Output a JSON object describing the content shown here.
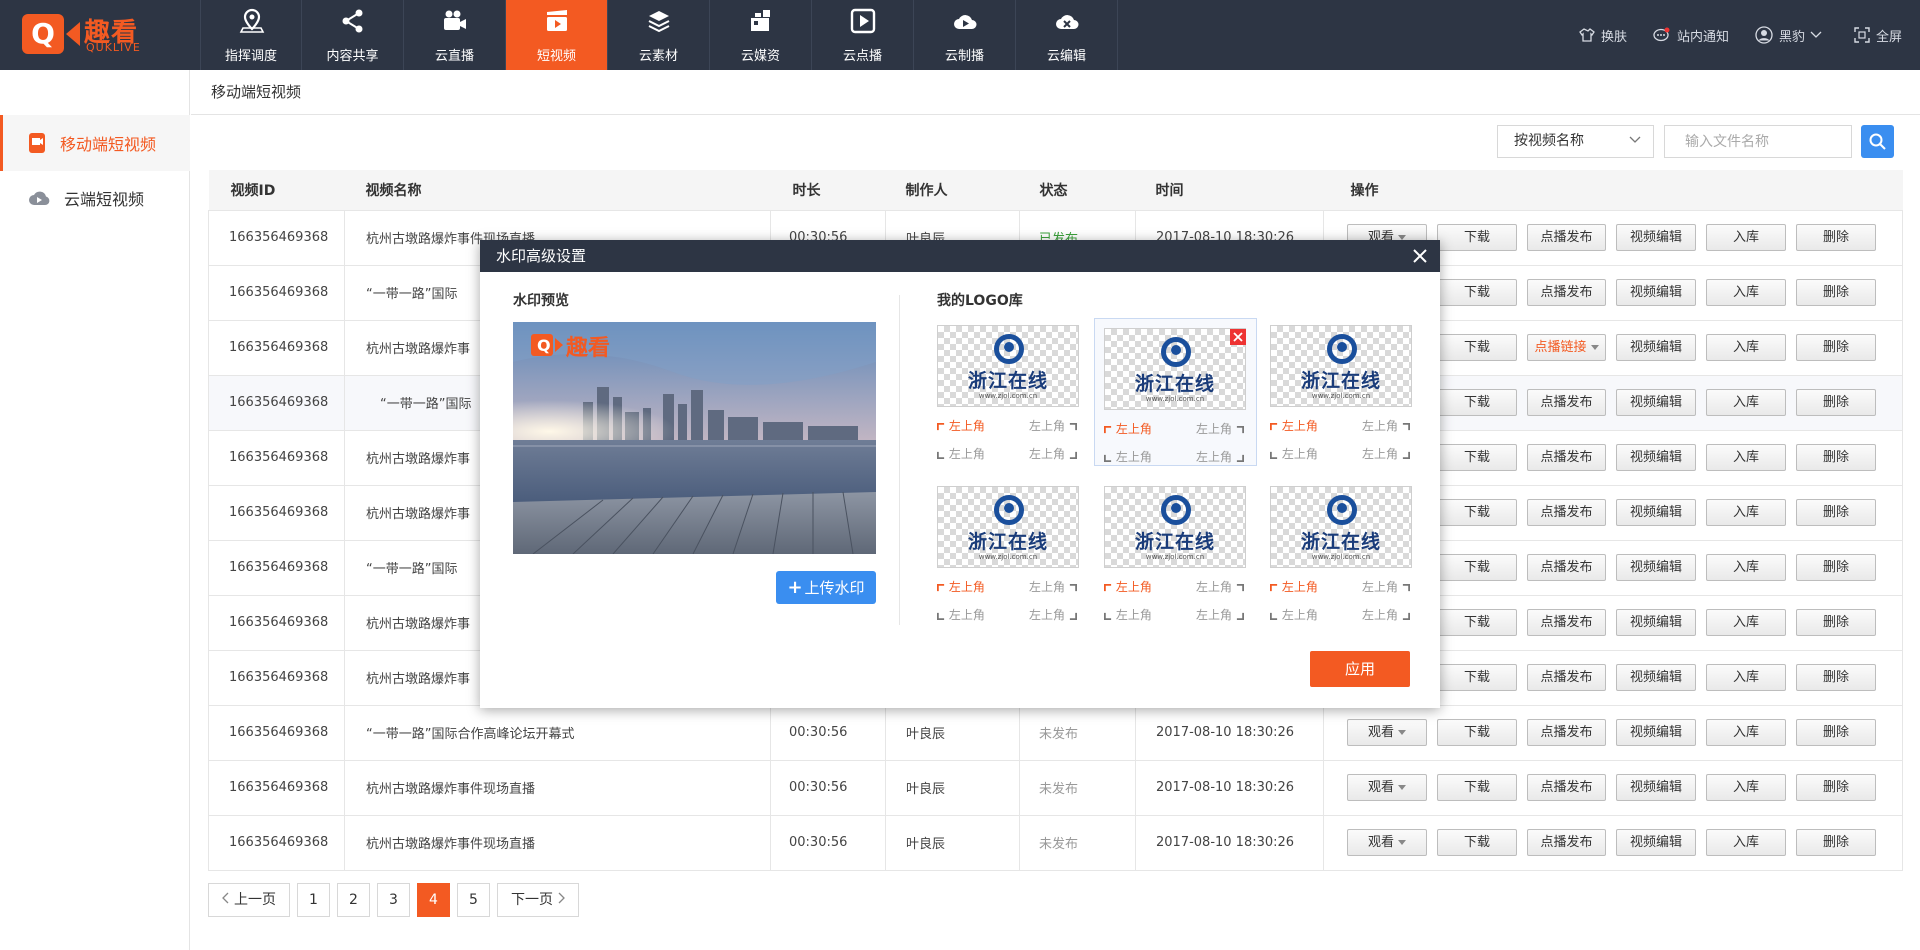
{
  "brand": {
    "logo_letter": "Q",
    "name_cn": "趣看",
    "name_en": "QUKLIVE",
    "color": "#f35a22"
  },
  "nav": [
    {
      "label": "指挥调度",
      "icon": "map-pin-icon"
    },
    {
      "label": "内容共享",
      "icon": "share-icon"
    },
    {
      "label": "云直播",
      "icon": "video-camera-icon"
    },
    {
      "label": "短视频",
      "icon": "clapperboard-icon",
      "active": true
    },
    {
      "label": "云素材",
      "icon": "layers-icon"
    },
    {
      "label": "云媒资",
      "icon": "media-asset-icon"
    },
    {
      "label": "云点播",
      "icon": "play-icon"
    },
    {
      "label": "云制播",
      "icon": "cloud-play-icon"
    },
    {
      "label": "云编辑",
      "icon": "cloud-edit-icon"
    }
  ],
  "top_right": {
    "skin": "换肤",
    "notice": "站内通知",
    "user": "黑豹",
    "fullscreen": "全屏"
  },
  "sidebar": {
    "items": [
      {
        "label": "移动端短视频",
        "active": true
      },
      {
        "label": "云端短视频"
      }
    ]
  },
  "breadcrumb": "移动端短视频",
  "search": {
    "select_value": "按视频名称",
    "placeholder": "输入文件名称"
  },
  "table": {
    "headers": [
      "视频ID",
      "视频名称",
      "时长",
      "制作人",
      "状态",
      "时间",
      "操作"
    ],
    "rows": [
      {
        "id": "166356469368",
        "name": "杭州古墩路爆炸事件现场直播",
        "duration": "00:30:56",
        "author": "叶良辰",
        "status": "已发布",
        "time": "2017-08-10  18:30:26"
      },
      {
        "id": "166356469368",
        "name": "“一带一路”国际"
      },
      {
        "id": "166356469368",
        "name": "杭州古墩路爆炸事"
      },
      {
        "id": "166356469368",
        "name": "“一带一路”国际"
      },
      {
        "id": "166356469368",
        "name": "杭州古墩路爆炸事"
      },
      {
        "id": "166356469368",
        "name": "杭州古墩路爆炸事"
      },
      {
        "id": "166356469368",
        "name": "“一带一路”国际"
      },
      {
        "id": "166356469368",
        "name": "杭州古墩路爆炸事"
      },
      {
        "id": "166356469368",
        "name": "杭州古墩路爆炸事"
      },
      {
        "id": "166356469368",
        "name": "“一带一路”国际合作高峰论坛开幕式",
        "duration": "00:30:56",
        "author": "叶良辰",
        "status": "未发布",
        "time": "2017-08-10  18:30:26"
      },
      {
        "id": "166356469368",
        "name": "杭州古墩路爆炸事件现场直播",
        "duration": "00:30:56",
        "author": "叶良辰",
        "status": "未发布",
        "time": "2017-08-10  18:30:26"
      },
      {
        "id": "166356469368",
        "name": "杭州古墩路爆炸事件现场直播",
        "duration": "00:30:56",
        "author": "叶良辰",
        "status": "未发布",
        "time": "2017-08-10  18:30:26"
      }
    ],
    "ops": {
      "watch": "观看",
      "download": "下载",
      "vod_publish": "点播发布",
      "vod_link": "点播链接",
      "video_edit": "视频编辑",
      "store": "入库",
      "delete": "删除"
    }
  },
  "pager": {
    "prev": "上一页",
    "next": "下一页",
    "pages": [
      "1",
      "2",
      "3",
      "4",
      "5"
    ],
    "current": "4"
  },
  "modal": {
    "title": "水印高级设置",
    "preview_label": "水印预览",
    "preview_logo_cn": "趣看",
    "upload_label": "上传水印",
    "library_label": "我的LOGO库",
    "logo_text": "浙江在线",
    "logo_url": "www.zjol.com.cn",
    "corners": [
      "左上角",
      "左上角",
      "左上角",
      "左上角"
    ],
    "apply_label": "应用"
  }
}
